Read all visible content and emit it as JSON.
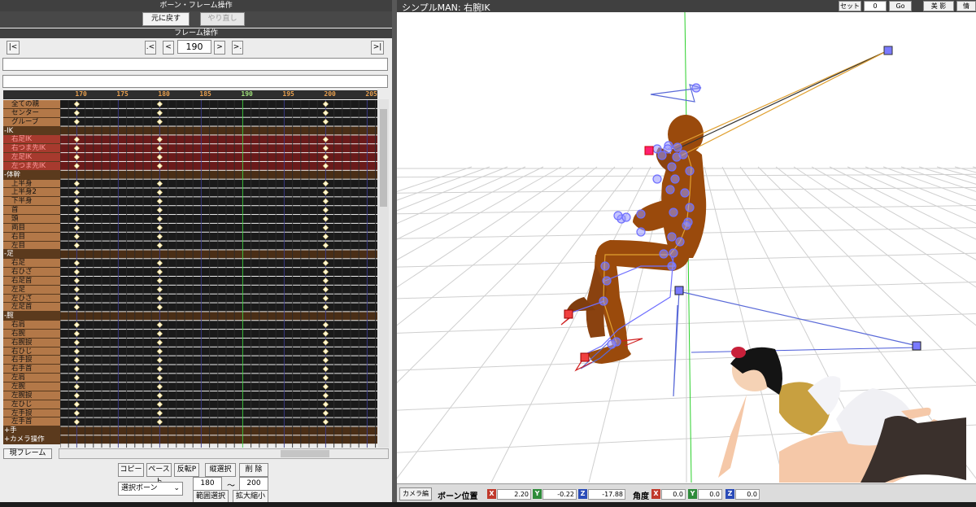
{
  "panel_title": "ボーン・フレーム操作",
  "undo_label": "元に戻す",
  "redo_label": "やり直し",
  "frame_section": "フレーム操作",
  "nav": {
    "first": "|<",
    "prev_key": ".<",
    "prev": "<",
    "current": "190",
    "next": ">",
    "next_key": ">.",
    "last": ">|"
  },
  "ruler": [
    "170",
    "175",
    "180",
    "185",
    "190",
    "195",
    "200",
    "205"
  ],
  "bones": [
    {
      "label": "全ての親",
      "kind": "bone"
    },
    {
      "label": "センター",
      "kind": "bone"
    },
    {
      "label": "グルーブ",
      "kind": "bone"
    },
    {
      "label": "-IK",
      "kind": "cat"
    },
    {
      "label": "右足IK",
      "kind": "sel"
    },
    {
      "label": "右つま先IK",
      "kind": "sel"
    },
    {
      "label": "左足IK",
      "kind": "sel"
    },
    {
      "label": "左つま先IK",
      "kind": "sel"
    },
    {
      "label": "-体幹",
      "kind": "cat"
    },
    {
      "label": "上半身",
      "kind": "bone"
    },
    {
      "label": "上半身2",
      "kind": "bone"
    },
    {
      "label": "下半身",
      "kind": "bone"
    },
    {
      "label": "首",
      "kind": "bone"
    },
    {
      "label": "頭",
      "kind": "bone"
    },
    {
      "label": "両目",
      "kind": "bone"
    },
    {
      "label": "右目",
      "kind": "bone"
    },
    {
      "label": "左目",
      "kind": "bone"
    },
    {
      "label": "-足",
      "kind": "cat"
    },
    {
      "label": "右足",
      "kind": "bone"
    },
    {
      "label": "右ひざ",
      "kind": "bone"
    },
    {
      "label": "右足首",
      "kind": "bone"
    },
    {
      "label": "左足",
      "kind": "bone"
    },
    {
      "label": "左ひざ",
      "kind": "bone"
    },
    {
      "label": "左足首",
      "kind": "bone"
    },
    {
      "label": "-腕",
      "kind": "cat"
    },
    {
      "label": "右肩",
      "kind": "bone"
    },
    {
      "label": "右腕",
      "kind": "bone"
    },
    {
      "label": "右腕捩",
      "kind": "bone"
    },
    {
      "label": "右ひじ",
      "kind": "bone"
    },
    {
      "label": "右手捩",
      "kind": "bone"
    },
    {
      "label": "右手首",
      "kind": "bone"
    },
    {
      "label": "左肩",
      "kind": "bone"
    },
    {
      "label": "左腕",
      "kind": "bone"
    },
    {
      "label": "左腕捩",
      "kind": "bone"
    },
    {
      "label": "左ひじ",
      "kind": "bone"
    },
    {
      "label": "左手捩",
      "kind": "bone"
    },
    {
      "label": "左手首",
      "kind": "bone"
    },
    {
      "label": "+手",
      "kind": "cat"
    },
    {
      "label": "+カメラ操作",
      "kind": "cat"
    }
  ],
  "keyframes": [
    170,
    180,
    200
  ],
  "current_frame_label": "現フレーム",
  "buttons": {
    "copy": "コピー",
    "paste": "ペースト",
    "reverse": "反転P",
    "vsel": "縦選択",
    "delete": "削 除",
    "range_sel": "範囲選択",
    "zoom": "拡大縮小"
  },
  "select_bone": "選択ボーン",
  "range": {
    "from": "180",
    "tilde": "～",
    "to": "200"
  },
  "viewport_title": "シンプルMAN: 右腕IK",
  "top_controls": {
    "set": "セット",
    "frame": "0",
    "go": "Go",
    "beauty": "美 影",
    "info": "情"
  },
  "camera_mode": "カメラ編",
  "bone_pos_label": "ボーン位置",
  "pos": {
    "x": "2.20",
    "y": "-0.22",
    "z": "-17.88"
  },
  "angle_label": "角度",
  "rot": {
    "x": "0.0",
    "y": "0.0",
    "z": "0.0"
  },
  "axis": {
    "x": "X",
    "y": "Y",
    "z": "Z"
  },
  "colors": {
    "x": "#c0392b",
    "y": "#2e8b3a",
    "z": "#2b4cb8",
    "skin": "#9a4a0c",
    "bone": "#6f6fff"
  }
}
